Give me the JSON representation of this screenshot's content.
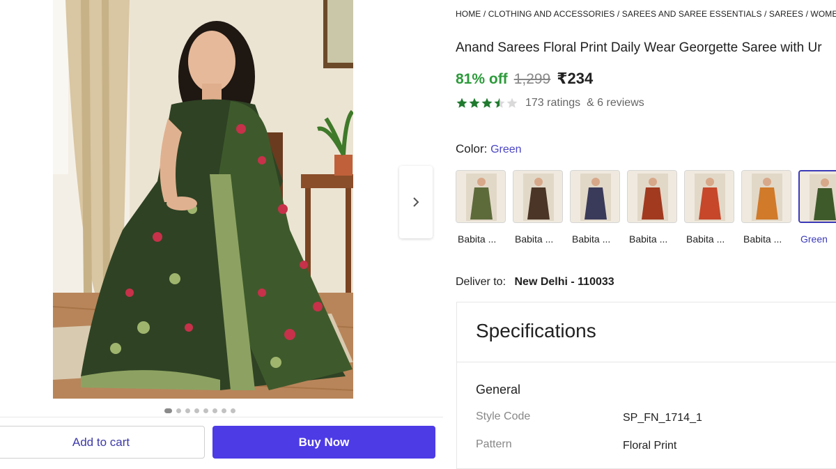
{
  "breadcrumb": "HOME / CLOTHING AND ACCESSORIES / SAREES AND SAREE ESSENTIALS / SAREES / WOMEN'S",
  "product": {
    "title": "Anand Sarees Floral Print Daily Wear Georgette Saree with Ur",
    "discount": "81% off",
    "mrp": "1,299",
    "price": "₹234",
    "rating": 3.5,
    "ratings_text": "173 ratings",
    "reviews_text": "& 6 reviews"
  },
  "color": {
    "label": "Color:",
    "value": "Green",
    "options": [
      {
        "label": "Babita ...",
        "tone": "#5d6b3a"
      },
      {
        "label": "Babita ...",
        "tone": "#4a3526"
      },
      {
        "label": "Babita ...",
        "tone": "#3a3a5a"
      },
      {
        "label": "Babita ...",
        "tone": "#a13a1f"
      },
      {
        "label": "Babita ...",
        "tone": "#c6472a"
      },
      {
        "label": "Babita ...",
        "tone": "#d07a2a"
      },
      {
        "label": "Green",
        "tone": "#3f5a2a",
        "selected": true
      }
    ]
  },
  "delivery": {
    "label": "Deliver to:",
    "location": "New Delhi - 110033"
  },
  "specifications": {
    "title": "Specifications",
    "section": "General",
    "rows": [
      {
        "key": "Style Code",
        "value": "SP_FN_1714_1"
      },
      {
        "key": "Pattern",
        "value": "Floral Print"
      }
    ]
  },
  "gallery": {
    "image_count": 8,
    "active_index": 0
  },
  "actions": {
    "add_to_cart": "Add to cart",
    "buy_now": "Buy Now"
  },
  "colors": {
    "discount_green": "#2c9a3a",
    "accent_blue": "#4d3be6",
    "link_blue": "#4a45c4",
    "star_green": "#1f7a2e"
  }
}
